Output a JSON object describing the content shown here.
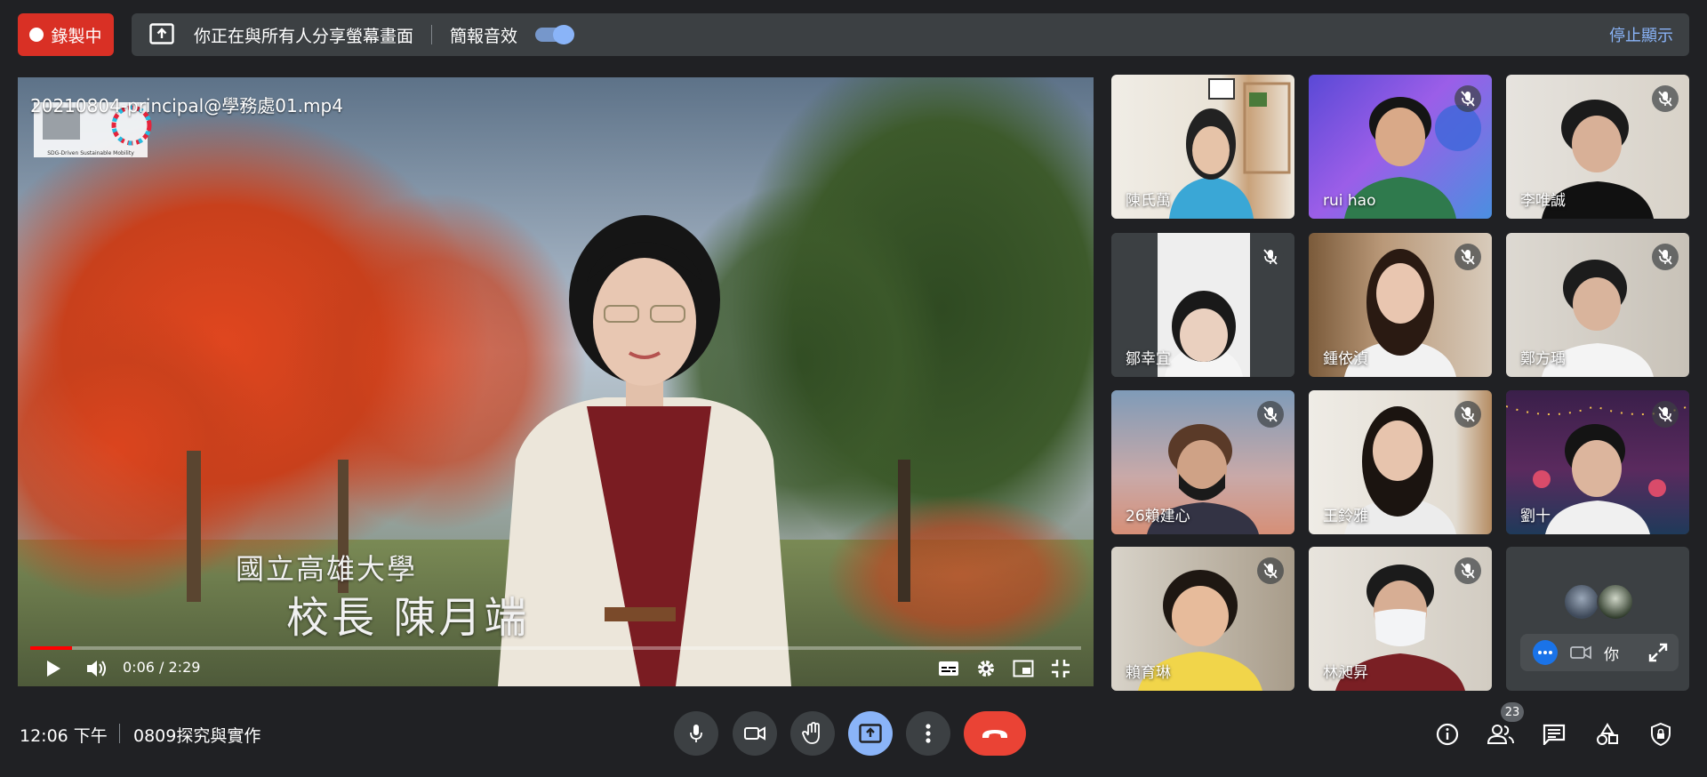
{
  "recording": {
    "label": "錄製中",
    "color": "#d93025"
  },
  "share_bar": {
    "message": "你正在與所有人分享螢幕畫面",
    "audio_label": "簡報音效",
    "audio_on": true,
    "stop_label": "停止顯示",
    "icon": "present-screen-icon"
  },
  "video": {
    "title": "20210804-principal@學務處01.mp4",
    "caption_line1": "國立高雄大學",
    "caption_line2": "校長 陳月端",
    "time": "0:06 / 2:29",
    "progress": 0.04,
    "logo_text": "SDG-Driven Sustainable Mobility"
  },
  "participants": [
    {
      "name": "陳氏萬",
      "muted": false
    },
    {
      "name": "rui hao",
      "muted": true
    },
    {
      "name": "李唯誠",
      "muted": true
    },
    {
      "name": "鄒幸宜",
      "muted": true
    },
    {
      "name": "鍾依湞",
      "muted": true
    },
    {
      "name": "鄭方瑀",
      "muted": true
    },
    {
      "name": "26賴建心",
      "muted": true
    },
    {
      "name": "王鈴雅",
      "muted": true
    },
    {
      "name": "劉十",
      "muted": true
    },
    {
      "name": "賴育琳",
      "muted": true
    },
    {
      "name": "林昶昇",
      "muted": true
    }
  ],
  "self_tile": {
    "label": "你"
  },
  "bottom": {
    "time": "12:06 下午",
    "meeting_name": "0809探究與實作",
    "participant_count": "23"
  },
  "colors": {
    "accent": "#8ab4f8",
    "hangup": "#ea4335",
    "background": "#202124",
    "surface": "#3c4043"
  }
}
